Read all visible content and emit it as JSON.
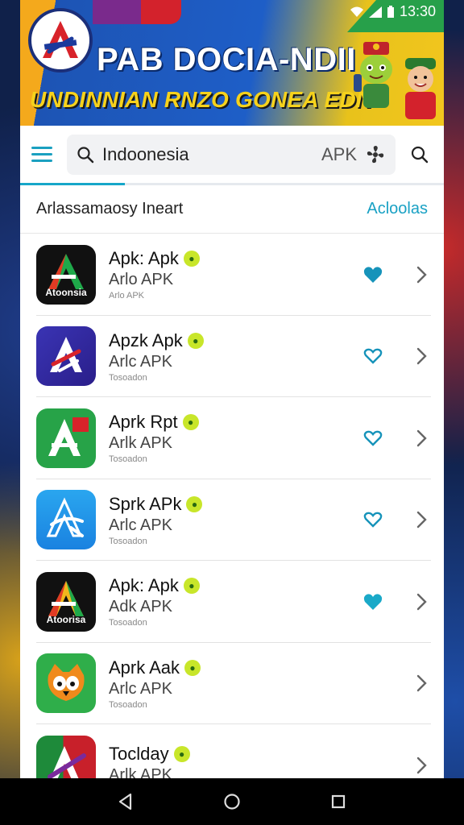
{
  "status_bar": {
    "time": "13:30"
  },
  "banner": {
    "title": "PAB DOCIA-NDII",
    "subtitle": "UNDINNIAN RNZO GONEA EDN"
  },
  "search": {
    "query": "Indoonesia",
    "tag": "APK"
  },
  "section": {
    "title": "Arlassamaosy Ineart",
    "link": "Acloolas"
  },
  "apps": [
    {
      "name": "Apk: Apk",
      "sub": "Arlo APK",
      "meta": "Arlo APK",
      "icon_caption": "Atoonsia",
      "favorited": true
    },
    {
      "name": "Apzk Apk",
      "sub": "Arlc APK",
      "meta": "Tosoadon",
      "icon_caption": "",
      "favorited": false
    },
    {
      "name": "Aprk Rpt",
      "sub": "Arlk APK",
      "meta": "Tosoadon",
      "icon_caption": "",
      "favorited": false
    },
    {
      "name": "Sprk APk",
      "sub": "Arlc APK",
      "meta": "Tosoadon",
      "icon_caption": "",
      "favorited": false
    },
    {
      "name": "Apk: Apk",
      "sub": "Adk APK",
      "meta": "Tosoadon",
      "icon_caption": "Atoorisa",
      "favorited": true
    },
    {
      "name": "Aprk Aak",
      "sub": "Arlc APK",
      "meta": "Tosoadon",
      "icon_caption": "",
      "favorited": null
    },
    {
      "name": "Toclday",
      "sub": "Arlk APK",
      "meta": "",
      "icon_caption": "",
      "favorited": null
    }
  ],
  "colors": {
    "accent": "#19a1c4",
    "verify_badge": "#c8e62a"
  }
}
